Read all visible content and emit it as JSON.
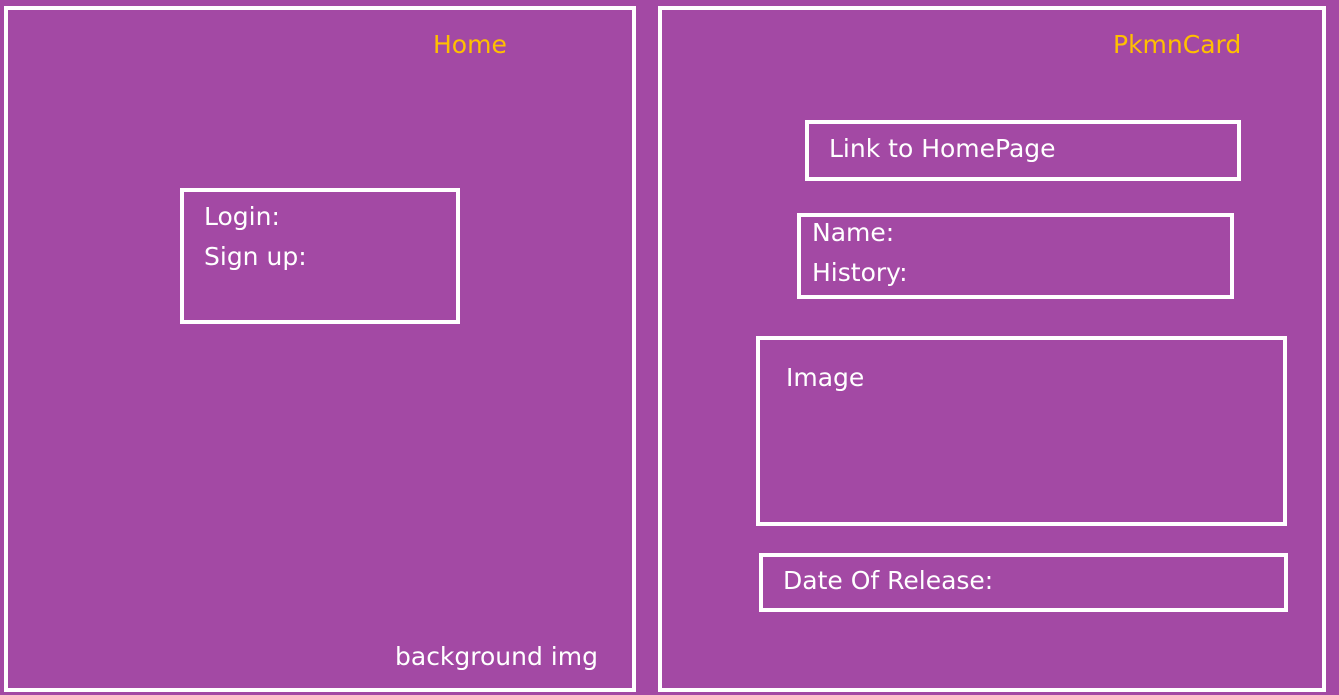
{
  "colors": {
    "background": "#a349a4",
    "border": "#ffffff",
    "title": "#ffc000",
    "text": "#ffffff"
  },
  "home": {
    "title": "Home",
    "auth_box": {
      "login_label": "Login:",
      "signup_label": "Sign up:"
    },
    "background_note": "background img"
  },
  "pkmn_card": {
    "title": "PkmnCard",
    "home_link_label": "Link to HomePage",
    "info_box": {
      "name_label": "Name:",
      "history_label": "History:"
    },
    "image_label": "Image",
    "release_date_label": "Date Of Release:"
  }
}
